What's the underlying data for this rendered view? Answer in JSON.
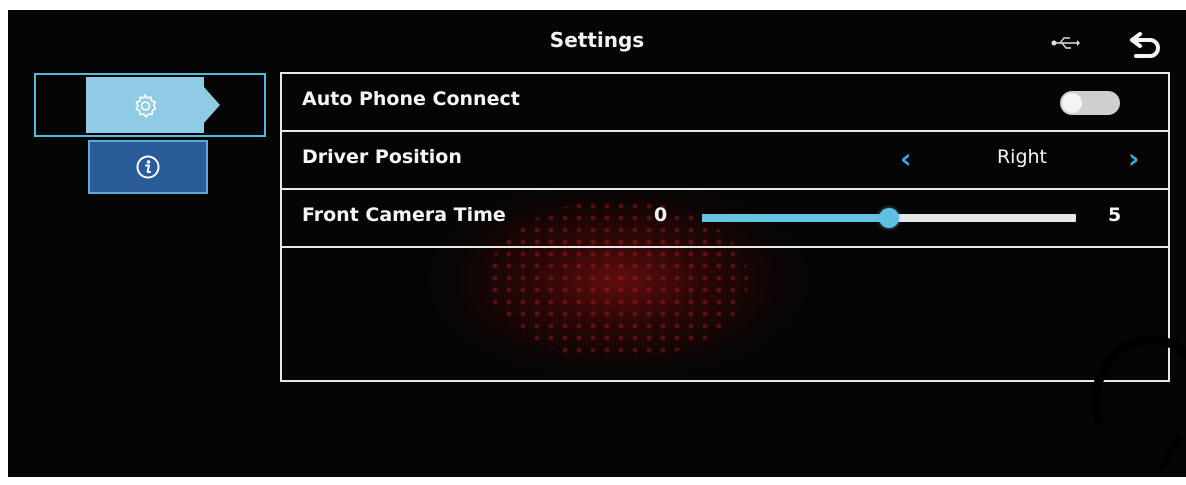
{
  "header": {
    "title": "Settings",
    "usb_icon": "usb-icon",
    "back_icon": "back-arrow-icon"
  },
  "sidebar": {
    "tabs": [
      {
        "icon": "gear-icon",
        "selected": true
      },
      {
        "icon": "info-icon",
        "selected": false
      }
    ]
  },
  "settings": {
    "rows": [
      {
        "label": "Auto Phone Connect",
        "control": "toggle",
        "state": "off"
      },
      {
        "label": "Driver Position",
        "control": "selector",
        "value": "Right"
      },
      {
        "label": "Front Camera Time",
        "control": "slider",
        "min_label": "0",
        "max_label": "5",
        "level": 0.5
      }
    ]
  },
  "colors": {
    "accent": "#5fc0e0",
    "selected_tab": "#8fcbe4",
    "info_tab": "#2a5c9a",
    "chevron": "#3aa7e0",
    "border": "#e8e8e8",
    "background": "#050505"
  }
}
